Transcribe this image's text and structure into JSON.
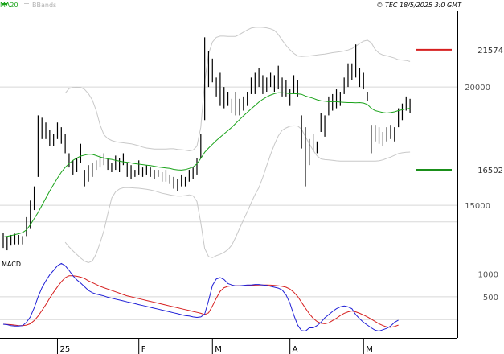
{
  "header": {
    "legend_ma20": "MA20",
    "legend_bbands": "BBands",
    "copyright": "© TEC 18/5/2025 3:0 GMT"
  },
  "colors": {
    "ma20": "#1aa31a",
    "bbands": "#c8c8c8",
    "bbands_legend": "#b0b0b0",
    "ohlc": "#000000",
    "grid": "#d8d8d8",
    "resistance": "#d61f1f",
    "support": "#1a8f1a",
    "macd": "#1f1fd6",
    "signal": "#d61f1f",
    "axis_text": "#555555"
  },
  "chart_data": [
    {
      "type": "ohlc",
      "title": "",
      "ylim": [
        13000,
        23200
      ],
      "y_ticks": [
        {
          "value": 20000,
          "label": "20000"
        },
        {
          "value": 15000,
          "label": "15000"
        }
      ],
      "x_labels": [
        {
          "index": 14,
          "label": "25"
        },
        {
          "index": 35,
          "label": "F"
        },
        {
          "index": 54,
          "label": "M"
        },
        {
          "index": 74,
          "label": "A"
        },
        {
          "index": 93,
          "label": "M"
        }
      ],
      "levels": [
        {
          "name": "resistance",
          "value": 21574,
          "label": "21574"
        },
        {
          "name": "support",
          "value": 16502,
          "label": "16502"
        }
      ],
      "bars": [
        [
          13850,
          13200
        ],
        [
          13700,
          13100
        ],
        [
          13750,
          13300
        ],
        [
          13800,
          13350
        ],
        [
          13750,
          13350
        ],
        [
          13700,
          13350
        ],
        [
          14500,
          13700
        ],
        [
          15200,
          14000
        ],
        [
          15800,
          14800
        ],
        [
          18800,
          16200
        ],
        [
          18700,
          17800
        ],
        [
          18500,
          17800
        ],
        [
          18200,
          17500
        ],
        [
          18000,
          17500
        ],
        [
          18500,
          17800
        ],
        [
          18300,
          17600
        ],
        [
          18000,
          17200
        ],
        [
          17200,
          16600
        ],
        [
          16900,
          16300
        ],
        [
          17000,
          16400
        ],
        [
          17600,
          16800
        ],
        [
          16500,
          15800
        ],
        [
          16700,
          16000
        ],
        [
          16800,
          16200
        ],
        [
          16900,
          16500
        ],
        [
          17100,
          16600
        ],
        [
          17200,
          16700
        ],
        [
          17000,
          16500
        ],
        [
          16800,
          16400
        ],
        [
          17100,
          16500
        ],
        [
          17000,
          16400
        ],
        [
          17200,
          16700
        ],
        [
          16800,
          16200
        ],
        [
          16700,
          16100
        ],
        [
          16500,
          16200
        ],
        [
          16900,
          16300
        ],
        [
          16600,
          16200
        ],
        [
          16700,
          16300
        ],
        [
          16600,
          16200
        ],
        [
          16500,
          16100
        ],
        [
          16500,
          16200
        ],
        [
          16400,
          16000
        ],
        [
          16500,
          16000
        ],
        [
          16300,
          15900
        ],
        [
          16200,
          15700
        ],
        [
          16100,
          15600
        ],
        [
          16300,
          15800
        ],
        [
          16200,
          15800
        ],
        [
          16500,
          16000
        ],
        [
          16600,
          16100
        ],
        [
          17000,
          16300
        ],
        [
          18000,
          17000
        ],
        [
          22100,
          18600
        ],
        [
          21500,
          20000
        ],
        [
          21200,
          20200
        ],
        [
          20400,
          19600
        ],
        [
          20600,
          19200
        ],
        [
          20000,
          19100
        ],
        [
          19800,
          19200
        ],
        [
          19500,
          18900
        ],
        [
          19800,
          18800
        ],
        [
          19500,
          18800
        ],
        [
          19600,
          19000
        ],
        [
          19800,
          19200
        ],
        [
          20400,
          19700
        ],
        [
          20600,
          19700
        ],
        [
          20800,
          20000
        ],
        [
          20500,
          19700
        ],
        [
          20400,
          19800
        ],
        [
          20600,
          20000
        ],
        [
          20500,
          19800
        ],
        [
          20900,
          19900
        ],
        [
          20400,
          19600
        ],
        [
          20300,
          19600
        ],
        [
          19900,
          19200
        ],
        [
          20500,
          19700
        ],
        [
          20300,
          19600
        ],
        [
          18800,
          17400
        ],
        [
          18300,
          15800
        ],
        [
          17800,
          16700
        ],
        [
          18000,
          17300
        ],
        [
          17700,
          17200
        ],
        [
          18900,
          18100
        ],
        [
          18800,
          17900
        ],
        [
          19600,
          18800
        ],
        [
          19700,
          19000
        ],
        [
          19900,
          19100
        ],
        [
          19800,
          19200
        ],
        [
          20400,
          19700
        ],
        [
          21000,
          20000
        ],
        [
          21000,
          20300
        ],
        [
          21800,
          20400
        ],
        [
          20800,
          20000
        ],
        [
          20600,
          19900
        ],
        [
          19800,
          19400
        ],
        [
          18400,
          17200
        ],
        [
          18400,
          17700
        ],
        [
          18300,
          17600
        ],
        [
          18100,
          17500
        ],
        [
          18300,
          17700
        ],
        [
          18400,
          17800
        ],
        [
          18300,
          17700
        ],
        [
          19100,
          18300
        ],
        [
          19300,
          18600
        ],
        [
          19600,
          19000
        ],
        [
          19500,
          18900
        ]
      ],
      "ma20": [
        13660,
        13690,
        13720,
        13760,
        13800,
        13850,
        13960,
        14180,
        14440,
        14700,
        15000,
        15300,
        15600,
        15880,
        16150,
        16400,
        16600,
        16760,
        16900,
        17000,
        17080,
        17120,
        17160,
        17150,
        17100,
        17040,
        17000,
        16960,
        16940,
        16900,
        16870,
        16840,
        16820,
        16790,
        16760,
        16740,
        16720,
        16700,
        16680,
        16650,
        16620,
        16600,
        16580,
        16560,
        16520,
        16500,
        16490,
        16510,
        16560,
        16620,
        16750,
        16980,
        17240,
        17420,
        17580,
        17740,
        17880,
        18020,
        18160,
        18300,
        18460,
        18620,
        18780,
        18930,
        19080,
        19220,
        19360,
        19480,
        19580,
        19660,
        19720,
        19760,
        19760,
        19740,
        19720,
        19720,
        19710,
        19690,
        19620,
        19570,
        19520,
        19460,
        19420,
        19400,
        19380,
        19380,
        19380,
        19360,
        19350,
        19340,
        19340,
        19330,
        19340,
        19320,
        19260,
        19100,
        19000,
        18960,
        18920,
        18900,
        18920,
        18950,
        19000,
        19040,
        19080,
        19100
      ],
      "bb_upper": [
        null,
        null,
        null,
        null,
        null,
        null,
        null,
        null,
        null,
        null,
        null,
        null,
        null,
        null,
        null,
        null,
        19740,
        19930,
        19980,
        19990,
        19980,
        19900,
        19720,
        19450,
        19000,
        18400,
        17980,
        17820,
        17740,
        17690,
        17660,
        17640,
        17620,
        17600,
        17560,
        17520,
        17460,
        17420,
        17400,
        17380,
        17380,
        17380,
        17380,
        17390,
        17390,
        17360,
        17350,
        17330,
        17300,
        17330,
        17500,
        18300,
        20200,
        21400,
        21900,
        22100,
        22150,
        22150,
        22140,
        22140,
        22140,
        22220,
        22320,
        22410,
        22490,
        22520,
        22530,
        22520,
        22500,
        22460,
        22390,
        22220,
        21980,
        21760,
        21570,
        21420,
        21310,
        21290,
        21300,
        21310,
        21330,
        21350,
        21370,
        21390,
        21420,
        21450,
        21470,
        21490,
        21520,
        21560,
        21620,
        21720,
        21840,
        21940,
        21980,
        21870,
        21590,
        21430,
        21350,
        21320,
        21270,
        21220,
        21150,
        21140,
        21120,
        21080
      ],
      "bb_lower": [
        null,
        null,
        null,
        null,
        null,
        null,
        null,
        null,
        null,
        null,
        null,
        null,
        null,
        null,
        null,
        null,
        13440,
        13240,
        13070,
        12920,
        12770,
        12640,
        12580,
        12650,
        12950,
        13410,
        13930,
        14640,
        15310,
        15570,
        15690,
        15740,
        15750,
        15740,
        15730,
        15720,
        15700,
        15680,
        15650,
        15610,
        15560,
        15510,
        15480,
        15440,
        15410,
        15390,
        15390,
        15410,
        15440,
        15400,
        15160,
        14260,
        13180,
        12830,
        12790,
        12870,
        12930,
        13010,
        13130,
        13320,
        13650,
        14020,
        14380,
        14730,
        15110,
        15450,
        15750,
        16180,
        16680,
        17150,
        17570,
        17930,
        18170,
        18270,
        18340,
        18360,
        18350,
        18220,
        17900,
        17600,
        17320,
        17090,
        16960,
        16930,
        16920,
        16900,
        16880,
        16870,
        16870,
        16870,
        16870,
        16870,
        16870,
        16870,
        16870,
        16870,
        16870,
        16880,
        16920,
        16980,
        17040,
        17110,
        17190,
        17220,
        17240,
        17250
      ]
    },
    {
      "type": "line",
      "title": "MACD",
      "ylim": [
        -400,
        1450
      ],
      "y_ticks": [
        {
          "value": 1000,
          "label": "1000"
        },
        {
          "value": 500,
          "label": "500"
        }
      ],
      "series": [
        {
          "name": "",
          "values": [
            -100,
            -110,
            -130,
            -140,
            -140,
            -130,
            -60,
            60,
            260,
            500,
            700,
            850,
            980,
            1080,
            1180,
            1230,
            1180,
            1080,
            960,
            870,
            800,
            720,
            640,
            590,
            560,
            540,
            520,
            490,
            470,
            450,
            430,
            410,
            390,
            370,
            350,
            330,
            310,
            290,
            270,
            250,
            230,
            210,
            190,
            170,
            150,
            130,
            110,
            90,
            80,
            60,
            50,
            60,
            120,
            420,
            750,
            890,
            920,
            880,
            790,
            760,
            740,
            740,
            750,
            760,
            760,
            770,
            770,
            760,
            750,
            730,
            710,
            690,
            650,
            540,
            360,
            100,
            -120,
            -240,
            -250,
            -180,
            -180,
            -130,
            -60,
            40,
            110,
            180,
            240,
            280,
            300,
            280,
            240,
            110,
            20,
            -60,
            -120,
            -180,
            -230,
            -250,
            -220,
            -190,
            -140,
            -60,
            -10
          ]
        },
        {
          "name": "",
          "values": [
            -100,
            -105,
            -110,
            -120,
            -130,
            -130,
            -120,
            -90,
            -20,
            80,
            200,
            330,
            470,
            600,
            720,
            830,
            920,
            960,
            960,
            950,
            930,
            900,
            850,
            810,
            770,
            730,
            700,
            670,
            640,
            610,
            580,
            550,
            520,
            500,
            480,
            460,
            440,
            420,
            400,
            380,
            360,
            340,
            320,
            300,
            280,
            260,
            240,
            220,
            200,
            180,
            160,
            140,
            110,
            150,
            300,
            470,
            620,
            700,
            730,
            740,
            740,
            740,
            740,
            745,
            750,
            755,
            760,
            760,
            760,
            755,
            750,
            740,
            730,
            710,
            670,
            600,
            510,
            380,
            250,
            130,
            30,
            -40,
            -80,
            -90,
            -70,
            -20,
            30,
            90,
            140,
            170,
            190,
            170,
            140,
            100,
            60,
            10,
            -40,
            -90,
            -130,
            -160,
            -170,
            -150,
            -120
          ]
        }
      ]
    }
  ]
}
